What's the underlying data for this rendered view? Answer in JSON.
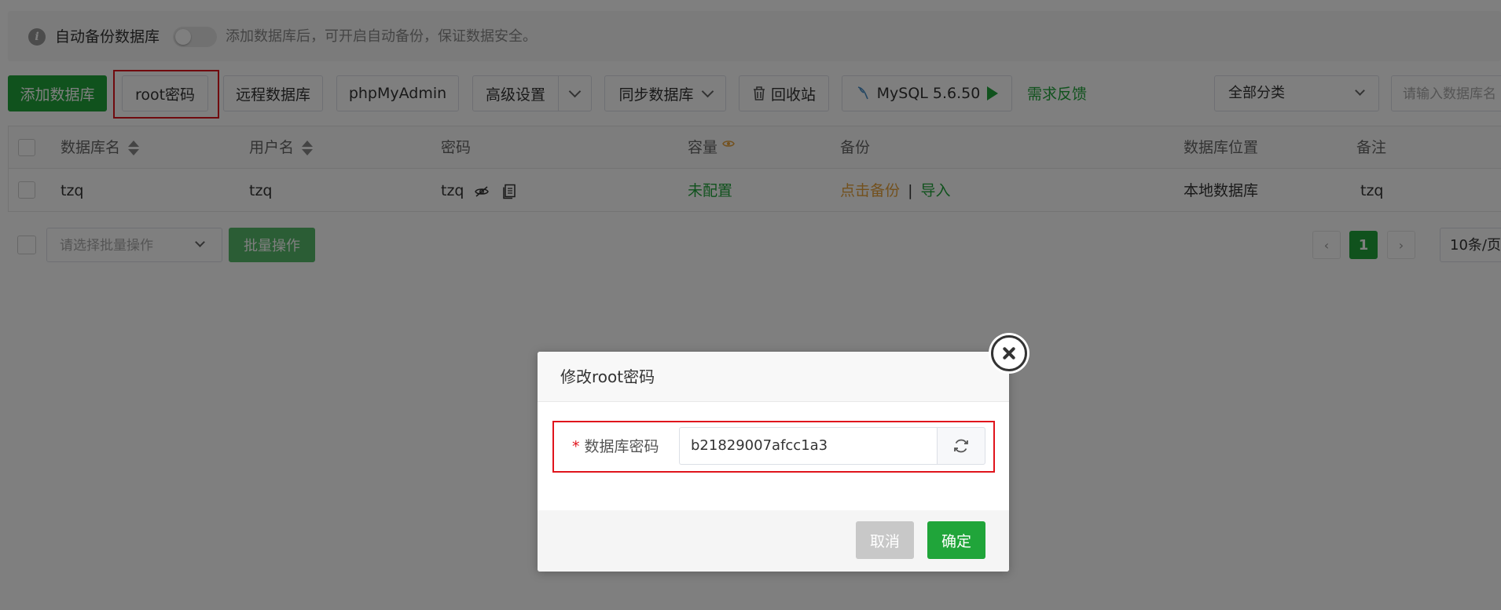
{
  "notice": {
    "label": "自动备份数据库",
    "hint": "添加数据库后，可开启自动备份，保证数据安全。",
    "toggle_on": false
  },
  "toolbar": {
    "add_db": "添加数据库",
    "root_password": "root密码",
    "remote_db": "远程数据库",
    "phpmyadmin": "phpMyAdmin",
    "advanced": "高级设置",
    "sync": "同步数据库",
    "recycle": "回收站",
    "mysql_version": "MySQL 5.6.50",
    "feedback": "需求反馈",
    "category": "全部分类",
    "search_placeholder": "请输入数据库名"
  },
  "table": {
    "headers": {
      "name": "数据库名",
      "user": "用户名",
      "password": "密码",
      "capacity": "容量",
      "backup": "备份",
      "location": "数据库位置",
      "note": "备注"
    },
    "rows": [
      {
        "name": "tzq",
        "user": "tzq",
        "password": "tzq",
        "capacity": "未配置",
        "backup_action": "点击备份",
        "separator": "|",
        "import_action": "导入",
        "location": "本地数据库",
        "note": "tzq"
      }
    ]
  },
  "batch": {
    "placeholder": "请选择批量操作",
    "button": "批量操作"
  },
  "pagination": {
    "current": "1",
    "page_size": "10条/页"
  },
  "dialog": {
    "title": "修改root密码",
    "field_required_mark": "*",
    "field_label": "数据库密码",
    "password_value": "b21829007afcc1a3",
    "cancel": "取消",
    "confirm": "确定"
  },
  "colors": {
    "accent": "#20a53a",
    "highlight": "#e0141c",
    "warning": "#e6a23c"
  }
}
